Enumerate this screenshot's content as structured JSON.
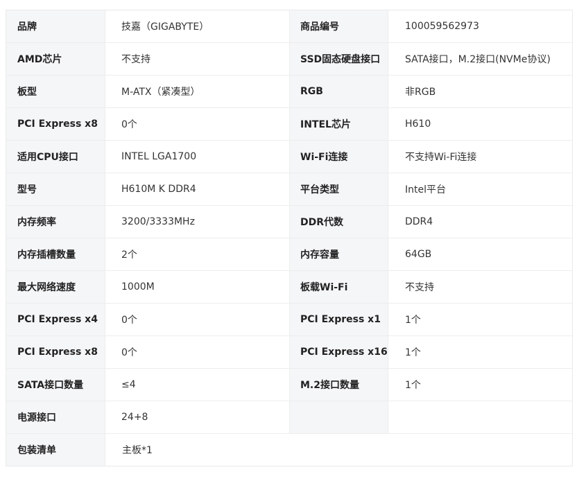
{
  "specs": {
    "rows": [
      {
        "l1": "品牌",
        "v1": "技嘉（GIGABYTE）",
        "l2": "商品编号",
        "v2": "100059562973"
      },
      {
        "l1": "AMD芯片",
        "v1": "不支持",
        "l2": "SSD固态硬盘接口",
        "v2": "SATA接口，M.2接口(NVMe协议)"
      },
      {
        "l1": "板型",
        "v1": "M-ATX（紧凑型）",
        "l2": "RGB",
        "v2": "非RGB"
      },
      {
        "l1": "PCI Express x8",
        "v1": "0个",
        "l2": "INTEL芯片",
        "v2": "H610"
      },
      {
        "l1": "适用CPU接口",
        "v1": "INTEL LGA1700",
        "l2": "Wi-Fi连接",
        "v2": "不支持Wi-Fi连接"
      },
      {
        "l1": "型号",
        "v1": "H610M K DDR4",
        "l2": "平台类型",
        "v2": "Intel平台"
      },
      {
        "l1": "内存频率",
        "v1": "3200/3333MHz",
        "l2": "DDR代数",
        "v2": "DDR4"
      },
      {
        "l1": "内存插槽数量",
        "v1": "2个",
        "l2": "内存容量",
        "v2": "64GB"
      },
      {
        "l1": "最大网络速度",
        "v1": "1000M",
        "l2": "板载Wi-Fi",
        "v2": "不支持"
      },
      {
        "l1": "PCI Express x4",
        "v1": "0个",
        "l2": "PCI Express x1",
        "v2": "1个"
      },
      {
        "l1": "PCI Express x8",
        "v1": "0个",
        "l2": "PCI Express x16",
        "v2": "1个"
      },
      {
        "l1": "SATA接口数量",
        "v1": "≤4",
        "l2": "M.2接口数量",
        "v2": "1个"
      },
      {
        "l1": "电源接口",
        "v1": "24+8",
        "l2": "",
        "v2": ""
      }
    ],
    "last_row": {
      "label": "包装清单",
      "value": "主板*1"
    }
  }
}
